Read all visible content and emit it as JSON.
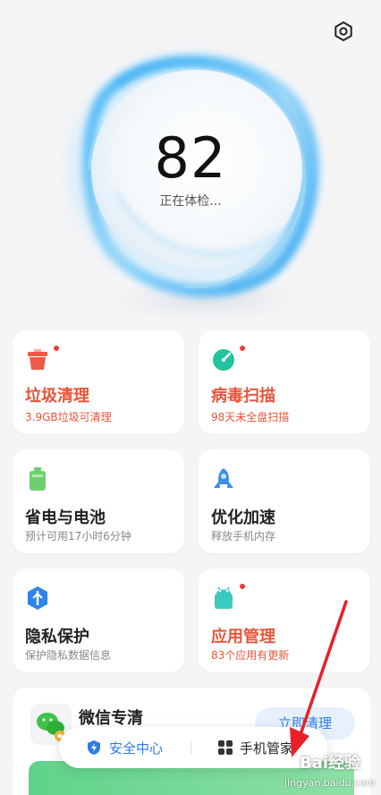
{
  "header": {
    "settings_icon": "gear-icon"
  },
  "checkup": {
    "score": "82",
    "status": "正在体检..."
  },
  "cards": [
    {
      "id": "junk",
      "title": "垃圾清理",
      "subtitle": "3.9GB垃圾可清理",
      "icon": "trash-icon",
      "color": "#ec5b45",
      "alert": true
    },
    {
      "id": "virus",
      "title": "病毒扫描",
      "subtitle": "98天未全盘扫描",
      "icon": "virus-scan-icon",
      "color": "#22c3a0",
      "alert": true
    },
    {
      "id": "battery",
      "title": "省电与电池",
      "subtitle": "预计可用17小时6分钟",
      "icon": "battery-icon",
      "color": "#6ecf6e",
      "alert": false
    },
    {
      "id": "speed",
      "title": "优化加速",
      "subtitle": "释放手机内存",
      "icon": "rocket-icon",
      "color": "#3a8ee8",
      "alert": false
    },
    {
      "id": "privacy",
      "title": "隐私保护",
      "subtitle": "保护隐私数据信息",
      "icon": "privacy-shield-icon",
      "color": "#2f84e6",
      "alert": false
    },
    {
      "id": "apps",
      "title": "应用管理",
      "subtitle": "83个应用有更新",
      "icon": "android-app-icon",
      "color": "#3cc9c2",
      "alert": true
    }
  ],
  "wechat": {
    "title": "微信专清",
    "button": "立即清理",
    "icon": "wechat-icon"
  },
  "bottom_nav": [
    {
      "label": "安全中心",
      "icon": "shield-icon",
      "color": "#2f7be6"
    },
    {
      "label": "手机管家",
      "icon": "grid-icon",
      "color": "#333333"
    }
  ],
  "watermark": {
    "brand": "Bai经验",
    "url": "jingyan.baidu.com"
  }
}
